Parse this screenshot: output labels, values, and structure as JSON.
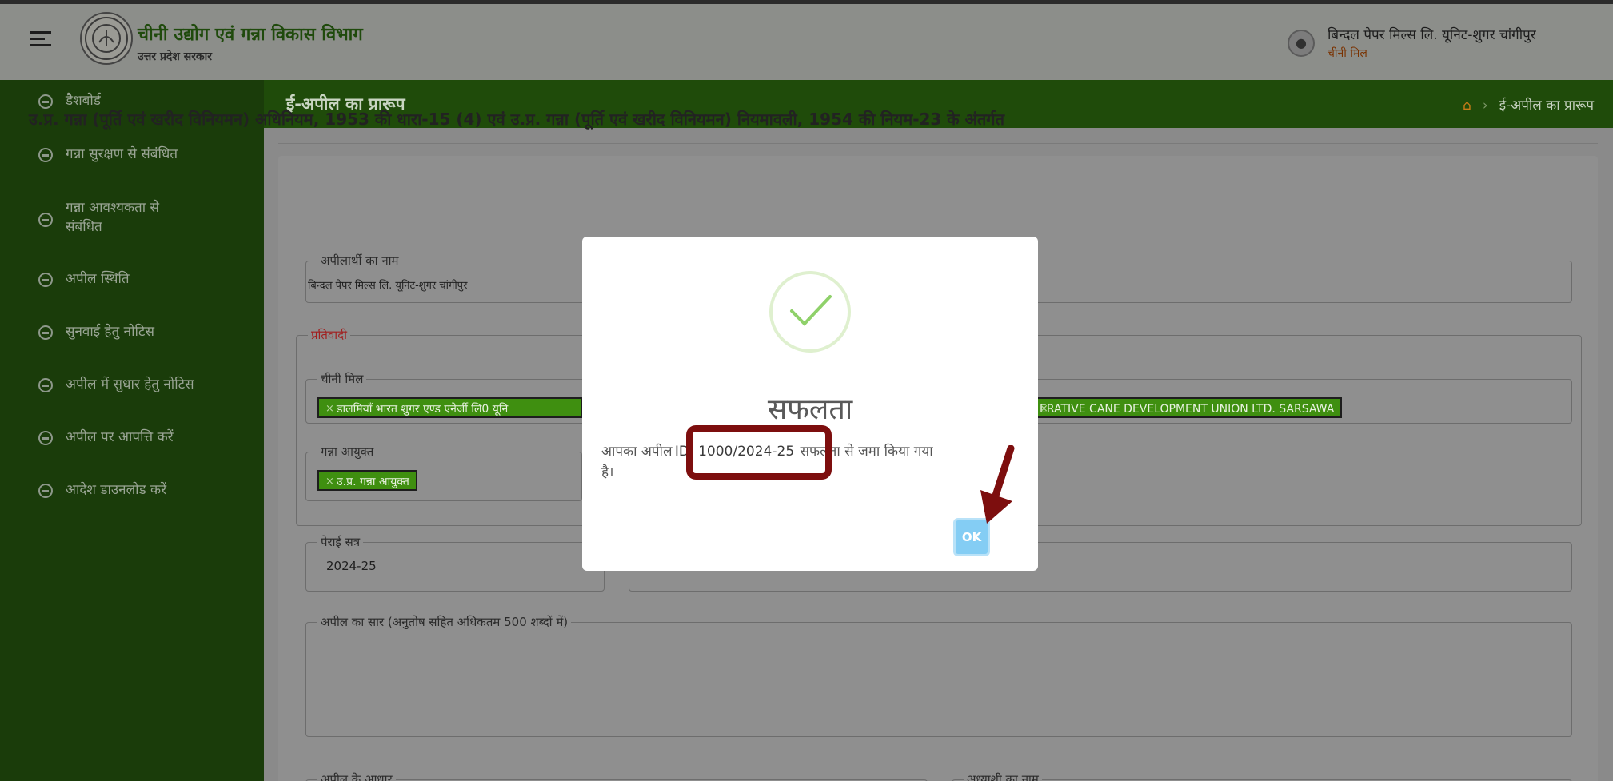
{
  "header": {
    "brand_title": "चीनी उद्योग एवं गन्ना विकास विभाग",
    "brand_subtitle": "उत्तर प्रदेश सरकार",
    "user_name": "बिन्दल पेपर मिल्स लि. यूनिट-शुगर चांगीपुर",
    "user_role": "चीनी मिल"
  },
  "sidebar": {
    "items": [
      {
        "label": "डैशबोर्ड"
      },
      {
        "label": "गन्ना सुरक्षण से संबंधित"
      },
      {
        "label": "गन्ना आवश्यकता से"
      },
      {
        "label": "अपील स्थिति"
      },
      {
        "label": "सुनवाई हेतु नोटिस"
      },
      {
        "label": "अपील में सुधार हेतु नोटिस"
      },
      {
        "label": "अपील पर आपत्ति करें"
      },
      {
        "label": "आदेश डाउनलोड करें"
      }
    ],
    "item3_line2": "संबंधित"
  },
  "pagebar": {
    "title": "ई-अपील का प्रारूप",
    "breadcrumb_current": "ई-अपील का प्रारूप"
  },
  "form": {
    "heading": "उ.प्र. गन्ना (पूर्ति एवं खरीद विनियमन) अधिनियम, 1953 की धारा-15 (4) एवं उ.प्र. गन्ना (पूर्ति एवं खरीद विनियमन) नियमावली, 1954 की नियम-23 के अंतर्गत",
    "appellant_label": "अपीलार्थी का नाम",
    "appellant_value": "बिन्दल पेपर मिल्स लि. यूनिट-शुगर चांगीपुर",
    "respondent_legend": "प्रतिवादी",
    "sugar_mill_label": "चीनी मिल",
    "sugar_mill_tag": "डालमियाँ भारत शुगर एण्ड एनेर्जी लि0 यूनि",
    "union_tag": "ERATIVE CANE DEVELOPMENT UNION LTD. SARSAWA",
    "commissioner_label": "गन्ना आयुक्त",
    "commissioner_tag": "उ.प्र. गन्ना आयुक्त",
    "season_label": "पेराई सत्र",
    "season_value": "2024-25",
    "summary_label": "अपील का सार (अनुतोष सहित अधिकतम 500 शब्दों में)",
    "grounds_label": "अपील के आधार",
    "applicant_label": "अध्याशी का नाम"
  },
  "modal": {
    "title": "सफलता",
    "message_pre": "आपका अपील",
    "message_id": "ID: 1000/2024-25",
    "message_post": "सफलता से जमा किया गया",
    "message_line2": "है।",
    "ok_label": "OK"
  },
  "colors": {
    "sidebar_bg": "#1a3c0a",
    "pagebar_bg": "#1f4b0a",
    "tag_green": "#3f8f10",
    "ok_button": "#84cdf4",
    "highlight": "#7d0e0e"
  }
}
